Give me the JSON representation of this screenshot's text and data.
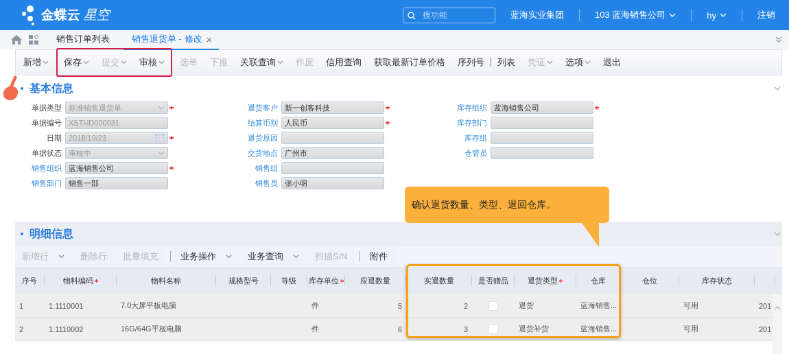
{
  "header": {
    "logo_text": "金蝶云",
    "logo_sub": "星空",
    "search": {
      "placeholder": "搜功能"
    },
    "org": "蓝海实业集团",
    "company": "103 蓝海销售公司",
    "user": "hy",
    "logout": "注销"
  },
  "tabs": [
    {
      "label": "销售订单列表",
      "selected": false
    },
    {
      "label": "销售退货单 - 修改",
      "selected": true,
      "close": "×"
    }
  ],
  "toolbar": {
    "groups": [
      {
        "highlighted": false,
        "items": [
          {
            "kind": "button",
            "label": "新增",
            "dropdown": true,
            "disabled": false
          }
        ]
      },
      {
        "highlighted": true,
        "items": [
          {
            "kind": "button",
            "label": "保存",
            "dropdown": true,
            "disabled": false
          },
          {
            "kind": "button",
            "label": "提交",
            "dropdown": true,
            "disabled": true
          },
          {
            "kind": "button",
            "label": "审核",
            "dropdown": true,
            "disabled": false
          }
        ]
      },
      {
        "highlighted": false,
        "items": [
          {
            "kind": "button",
            "label": "选单",
            "dropdown": false,
            "disabled": true
          },
          {
            "kind": "button",
            "label": "下推",
            "dropdown": false,
            "disabled": true
          },
          {
            "kind": "button",
            "label": "关联查询",
            "dropdown": true,
            "disabled": false
          },
          {
            "kind": "button",
            "label": "作废",
            "dropdown": false,
            "disabled": true
          },
          {
            "kind": "button",
            "label": "信用查询",
            "dropdown": false,
            "disabled": false
          },
          {
            "kind": "button",
            "label": "获取最新订单价格",
            "dropdown": false,
            "disabled": false
          },
          {
            "kind": "button",
            "label": "序列号",
            "dropdown": false,
            "disabled": false
          },
          {
            "kind": "divider"
          },
          {
            "kind": "button",
            "label": "列表",
            "dropdown": false,
            "disabled": false
          },
          {
            "kind": "button",
            "label": "凭证",
            "dropdown": true,
            "disabled": true
          },
          {
            "kind": "button",
            "label": "选项",
            "dropdown": true,
            "disabled": false
          },
          {
            "kind": "button",
            "label": "退出",
            "dropdown": false,
            "disabled": false
          }
        ]
      }
    ]
  },
  "basic_info": {
    "title": "基本信息",
    "columns": [
      [
        {
          "label": "单据类型",
          "link": false,
          "value": "标准销售退货单",
          "kind": "select",
          "required": true,
          "disabled": true
        },
        {
          "label": "单据编号",
          "link": false,
          "value": "XSTHD000031",
          "kind": "text",
          "required": false,
          "disabled": true
        },
        {
          "label": "日期",
          "link": false,
          "value": "2018/10/23",
          "kind": "date",
          "required": true,
          "disabled": true
        },
        {
          "label": "单据状态",
          "link": false,
          "value": "审核中",
          "kind": "select",
          "required": false,
          "disabled": true
        },
        {
          "label": "销售组织",
          "link": true,
          "value": "蓝海销售公司",
          "kind": "text",
          "required": true,
          "disabled": false
        },
        {
          "label": "销售部门",
          "link": true,
          "value": "销售一部",
          "kind": "text",
          "required": false,
          "disabled": false
        }
      ],
      [
        {
          "label": "退货客户",
          "link": true,
          "value": "新一创客科技",
          "kind": "text",
          "required": true,
          "disabled": false
        },
        {
          "label": "结算币别",
          "link": true,
          "value": "人民币",
          "kind": "text",
          "required": true,
          "disabled": false
        },
        {
          "label": "退货原因",
          "link": true,
          "kind": "text",
          "required": false,
          "disabled": false
        },
        {
          "label": "交货地点",
          "link": true,
          "value": "广州市",
          "kind": "text",
          "required": false,
          "disabled": false
        },
        {
          "label": "销售组",
          "link": true,
          "kind": "text",
          "required": false,
          "disabled": false
        },
        {
          "label": "销售员",
          "link": true,
          "value": "张小明",
          "kind": "text",
          "required": false,
          "disabled": false
        }
      ],
      [
        {
          "label": "库存组织",
          "link": true,
          "value": "蓝海销售公司",
          "kind": "text",
          "required": true,
          "disabled": false
        },
        {
          "label": "库存部门",
          "link": true,
          "kind": "text",
          "required": false,
          "disabled": false
        },
        {
          "label": "库存组",
          "link": true,
          "kind": "text",
          "required": false,
          "disabled": false
        },
        {
          "label": "仓管员",
          "link": true,
          "kind": "text",
          "required": false,
          "disabled": false
        }
      ]
    ]
  },
  "callout": {
    "text": "确认退货数量、类型、退回仓库。"
  },
  "detail": {
    "title": "明细信息",
    "toolbar": [
      {
        "kind": "button",
        "label": "新增行",
        "dropdown": true,
        "disabled": true
      },
      {
        "kind": "button",
        "label": "删除行",
        "dropdown": false,
        "disabled": true
      },
      {
        "kind": "button",
        "label": "批量填充",
        "dropdown": false,
        "disabled": true
      },
      {
        "kind": "divider"
      },
      {
        "kind": "button",
        "label": "业务操作",
        "dropdown": true,
        "disabled": false
      },
      {
        "kind": "button",
        "label": "业务查询",
        "dropdown": true,
        "disabled": false
      },
      {
        "kind": "button",
        "label": "扫描S/N",
        "dropdown": false,
        "disabled": true
      },
      {
        "kind": "divider"
      },
      {
        "kind": "button",
        "label": "附件",
        "dropdown": false,
        "disabled": false
      }
    ],
    "columns": [
      {
        "label": "序号",
        "required": false
      },
      {
        "label": "物料编码",
        "required": true
      },
      {
        "label": "物料名称",
        "required": false
      },
      {
        "label": "规格型号",
        "required": false
      },
      {
        "label": "等级",
        "required": false
      },
      {
        "label": "库存单位",
        "required": true
      },
      {
        "label": "应退数量",
        "required": false
      },
      {
        "label": "实退数量",
        "required": false,
        "highlighted": true
      },
      {
        "label": "是否赠品",
        "required": false,
        "highlighted": true
      },
      {
        "label": "退货类型",
        "required": true,
        "highlighted": true
      },
      {
        "label": "仓库",
        "required": false,
        "highlighted": true
      },
      {
        "label": "仓位",
        "required": false
      },
      {
        "label": "库存状态",
        "required": false
      },
      {
        "required": false
      }
    ],
    "rows": [
      {
        "no": "1",
        "code": "1.1110001",
        "name": "7.0大屏平板电脑",
        "unit": "件",
        "due_qty": "5",
        "actual_qty": "2",
        "gift": false,
        "return_type": "退货",
        "warehouse": "蓝海销售...",
        "stock_status": "可用",
        "column_14": "201"
      },
      {
        "no": "2",
        "code": "1.1110002",
        "name": "16G/64G平板电脑",
        "unit": "件",
        "due_qty": "6",
        "actual_qty": "3",
        "gift": false,
        "return_type": "退货补货",
        "warehouse": "蓝海销售...",
        "stock_status": "可用",
        "column_14": "201"
      }
    ]
  }
}
